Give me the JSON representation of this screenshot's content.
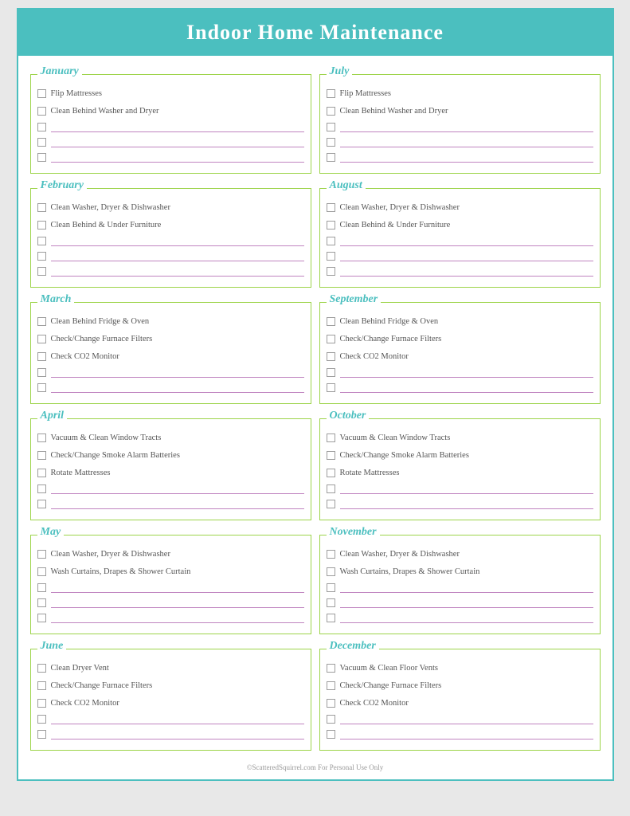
{
  "header": {
    "title": "Indoor Home Maintenance"
  },
  "months": [
    {
      "name": "January",
      "tasks": [
        "Flip Mattresses",
        "Clean Behind Washer and Dryer"
      ],
      "blankLines": 3
    },
    {
      "name": "July",
      "tasks": [
        "Flip Mattresses",
        "Clean Behind Washer and Dryer"
      ],
      "blankLines": 3
    },
    {
      "name": "February",
      "tasks": [
        "Clean Washer, Dryer & Dishwasher",
        "Clean Behind & Under Furniture"
      ],
      "blankLines": 3
    },
    {
      "name": "August",
      "tasks": [
        "Clean Washer, Dryer & Dishwasher",
        "Clean Behind & Under Furniture"
      ],
      "blankLines": 3
    },
    {
      "name": "March",
      "tasks": [
        "Clean Behind Fridge & Oven",
        "Check/Change Furnace Filters",
        "Check CO2 Monitor"
      ],
      "blankLines": 2
    },
    {
      "name": "September",
      "tasks": [
        "Clean Behind Fridge & Oven",
        "Check/Change Furnace Filters",
        "Check CO2 Monitor"
      ],
      "blankLines": 2
    },
    {
      "name": "April",
      "tasks": [
        "Vacuum & Clean Window Tracts",
        "Check/Change Smoke Alarm Batteries",
        "Rotate Mattresses"
      ],
      "blankLines": 2
    },
    {
      "name": "October",
      "tasks": [
        "Vacuum & Clean Window Tracts",
        "Check/Change Smoke Alarm Batteries",
        "Rotate Mattresses"
      ],
      "blankLines": 2
    },
    {
      "name": "May",
      "tasks": [
        "Clean Washer, Dryer & Dishwasher",
        "Wash Curtains, Drapes & Shower Curtain"
      ],
      "blankLines": 3
    },
    {
      "name": "November",
      "tasks": [
        "Clean Washer, Dryer & Dishwasher",
        "Wash Curtains, Drapes & Shower Curtain"
      ],
      "blankLines": 3
    },
    {
      "name": "June",
      "tasks": [
        "Clean Dryer Vent",
        "Check/Change Furnace Filters",
        "Check CO2 Monitor"
      ],
      "blankLines": 2
    },
    {
      "name": "December",
      "tasks": [
        "Vacuum & Clean Floor Vents",
        "Check/Change Furnace Filters",
        "Check CO2 Monitor"
      ],
      "blankLines": 2
    }
  ],
  "footer": {
    "text": "©ScatteredSquirrel.com    For Personal Use Only"
  }
}
